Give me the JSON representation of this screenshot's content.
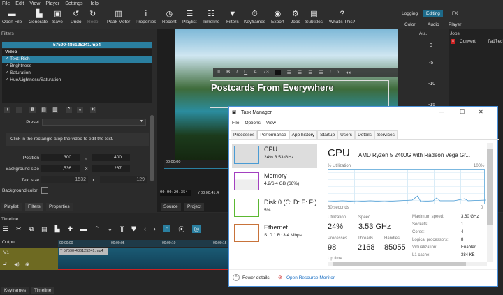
{
  "menu": [
    "File",
    "Edit",
    "View",
    "Player",
    "Settings",
    "Help"
  ],
  "toolbar": [
    {
      "label": "Open File",
      "icon": "folder-icon"
    },
    {
      "label": "Generate_",
      "icon": "generate-icon"
    },
    {
      "label": "Save",
      "icon": "save-icon"
    },
    {
      "label": "Undo",
      "icon": "undo-icon"
    },
    {
      "label": "Redo",
      "icon": "redo-icon"
    },
    {
      "label": "Peak Meter",
      "icon": "peak-meter-icon"
    },
    {
      "label": "Properties",
      "icon": "info-icon"
    },
    {
      "label": "Recent",
      "icon": "clock-icon"
    },
    {
      "label": "Playlist",
      "icon": "list-icon"
    },
    {
      "label": "Timeline",
      "icon": "timeline-icon"
    },
    {
      "label": "Filters",
      "icon": "funnel-icon"
    },
    {
      "label": "Keyframes",
      "icon": "stopwatch-icon"
    },
    {
      "label": "Export",
      "icon": "disc-icon"
    },
    {
      "label": "Jobs",
      "icon": "gear-icon"
    },
    {
      "label": "Subtitles",
      "icon": "subtitles-icon"
    },
    {
      "label": "What's This?",
      "icon": "question-icon"
    }
  ],
  "workspaces": [
    "Logging",
    "Editing",
    "FX",
    "Color",
    "Audio",
    "Player"
  ],
  "filters": {
    "title": "Filters",
    "file": "57590-486125241.mp4",
    "group": "Video",
    "items": [
      "Text: Rich",
      "Brightness",
      "Saturation",
      "Hue/Lightness/Saturation"
    ],
    "preset_label": "Preset",
    "hint": "Click in the rectangle atop the video to edit the text.",
    "position_label": "Position",
    "position_x": "300",
    "position_y": "400",
    "bgsize_label": "Background size",
    "bgsize_w": "1,536",
    "bgsize_h": "267",
    "textsize_label": "Text size",
    "textsize_w": "1532",
    "textsize_h": "129",
    "bgcolor_label": "Background color",
    "sep_comma": ",",
    "sep_x": "x"
  },
  "left_tabs": [
    "Playlist",
    "Filters",
    "Properties"
  ],
  "player": {
    "title_text": "Postcards From Everywhere",
    "font_size": "73",
    "ruler_start": "00:00:00",
    "timecode": "00:00:20.354",
    "duration": "/ 00:00:41.4",
    "tabs": [
      "Source",
      "Project"
    ]
  },
  "audio": {
    "title": "Au...",
    "ticks": [
      "0",
      "-5",
      "-10",
      "-15"
    ]
  },
  "jobs": {
    "title": "Jobs",
    "job": "Convert",
    "status": "failed"
  },
  "timeline": {
    "title": "Timeline",
    "output": "Output",
    "track": "V1",
    "clip": "57590-486125241.mp4",
    "ticks": [
      "00:00:00",
      "00:00:05",
      "00:00:10",
      "00:00:15"
    ],
    "tabs": [
      "Keyframes",
      "Timeline"
    ]
  },
  "taskmgr": {
    "title": "Task Manager",
    "menu": [
      "File",
      "Options",
      "View"
    ],
    "tabs": [
      "Processes",
      "Performance",
      "App history",
      "Startup",
      "Users",
      "Details",
      "Services"
    ],
    "resources": [
      {
        "name": "CPU",
        "value": "24% 3.53 GHz",
        "color": "#4a9bd4"
      },
      {
        "name": "Memory",
        "value": "4.2/6.4 GB (66%)",
        "color": "#a340c0"
      },
      {
        "name": "Disk 0 (C: D: E: F:)",
        "value": "5%",
        "color": "#5cb832"
      },
      {
        "name": "Ethernet",
        "value": "S: 0.1 R: 3.4 Mbps",
        "color": "#c8733a"
      }
    ],
    "heading": "CPU",
    "cpu_model": "AMD Ryzen 5 2400G with Radeon Vega Gr...",
    "util_label": "% Utilization",
    "util_max": "100%",
    "seconds": "60 seconds",
    "zero": "0",
    "stats": [
      {
        "label": "Utilization",
        "value": "24%"
      },
      {
        "label": "Speed",
        "value": "3.53 GHz"
      },
      {
        "label": "Processes",
        "value": "98"
      },
      {
        "label": "Threads",
        "value": "2168"
      },
      {
        "label": "Handles",
        "value": "85055"
      }
    ],
    "uptime": "Up time",
    "specs": [
      [
        "Maximum speed:",
        "3.60 GHz"
      ],
      [
        "Sockets:",
        "1"
      ],
      [
        "Cores:",
        "4"
      ],
      [
        "Logical processors:",
        "8"
      ],
      [
        "Virtualization:",
        "Enabled"
      ],
      [
        "L1 cache:",
        "384 KB"
      ]
    ],
    "fewer": "Fewer details",
    "monitor": "Open Resource Monitor"
  }
}
